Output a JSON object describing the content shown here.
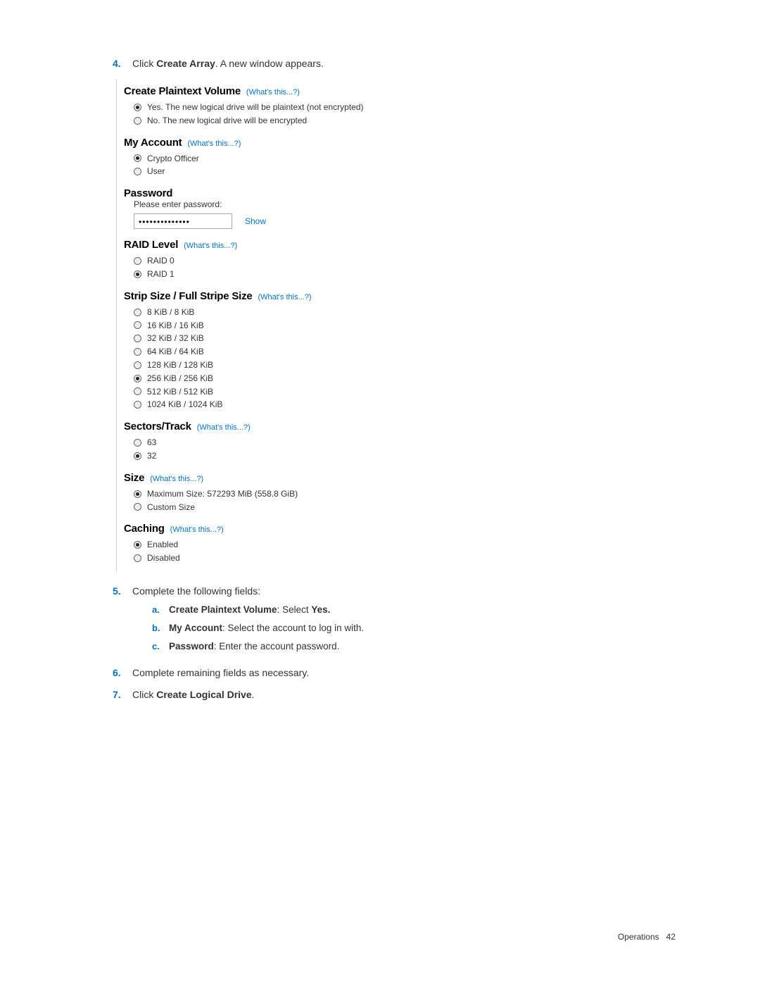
{
  "steps": {
    "s4": {
      "marker": "4.",
      "pre": "Click ",
      "bold": "Create Array",
      "post": ". A new window appears."
    },
    "s5": {
      "marker": "5.",
      "text": "Complete the following fields:",
      "subs": {
        "a": {
          "marker": "a.",
          "bold": "Create Plaintext Volume",
          "post": ": Select ",
          "bold2": "Yes."
        },
        "b": {
          "marker": "b.",
          "bold": "My Account",
          "post": ": Select the account to log in with."
        },
        "c": {
          "marker": "c.",
          "bold": "Password",
          "post": ": Enter the account password."
        }
      }
    },
    "s6": {
      "marker": "6.",
      "text": "Complete remaining fields as necessary."
    },
    "s7": {
      "marker": "7.",
      "pre": "Click ",
      "bold": "Create Logical Drive",
      "post": "."
    }
  },
  "whats": "(What's this...?)",
  "figure": {
    "plaintext": {
      "title": "Create Plaintext Volume",
      "opts": [
        {
          "label": "Yes. The new logical drive will be plaintext (not encrypted)",
          "sel": true
        },
        {
          "label": "No. The new logical drive will be encrypted",
          "sel": false
        }
      ]
    },
    "account": {
      "title": "My Account",
      "opts": [
        {
          "label": "Crypto Officer",
          "sel": true
        },
        {
          "label": "User",
          "sel": false
        }
      ]
    },
    "password": {
      "title": "Password",
      "label": "Please enter password:",
      "value": "••••••••••••••",
      "show": "Show"
    },
    "raid": {
      "title": "RAID Level",
      "opts": [
        {
          "label": "RAID 0",
          "sel": false
        },
        {
          "label": "RAID 1",
          "sel": true
        }
      ]
    },
    "strip": {
      "title": "Strip Size / Full Stripe Size",
      "opts": [
        {
          "label": "8 KiB / 8 KiB",
          "sel": false
        },
        {
          "label": "16 KiB / 16 KiB",
          "sel": false
        },
        {
          "label": "32 KiB / 32 KiB",
          "sel": false
        },
        {
          "label": "64 KiB / 64 KiB",
          "sel": false
        },
        {
          "label": "128 KiB / 128 KiB",
          "sel": false
        },
        {
          "label": "256 KiB / 256 KiB",
          "sel": true
        },
        {
          "label": "512 KiB / 512 KiB",
          "sel": false
        },
        {
          "label": "1024 KiB / 1024 KiB",
          "sel": false
        }
      ]
    },
    "sectors": {
      "title": "Sectors/Track",
      "opts": [
        {
          "label": "63",
          "sel": false
        },
        {
          "label": "32",
          "sel": true
        }
      ]
    },
    "size": {
      "title": "Size",
      "opts": [
        {
          "label": "Maximum Size: 572293 MiB (558.8 GiB)",
          "sel": true
        },
        {
          "label": "Custom Size",
          "sel": false
        }
      ]
    },
    "caching": {
      "title": "Caching",
      "opts": [
        {
          "label": "Enabled",
          "sel": true
        },
        {
          "label": "Disabled",
          "sel": false
        }
      ]
    }
  },
  "footer": {
    "section": "Operations",
    "page": "42"
  }
}
